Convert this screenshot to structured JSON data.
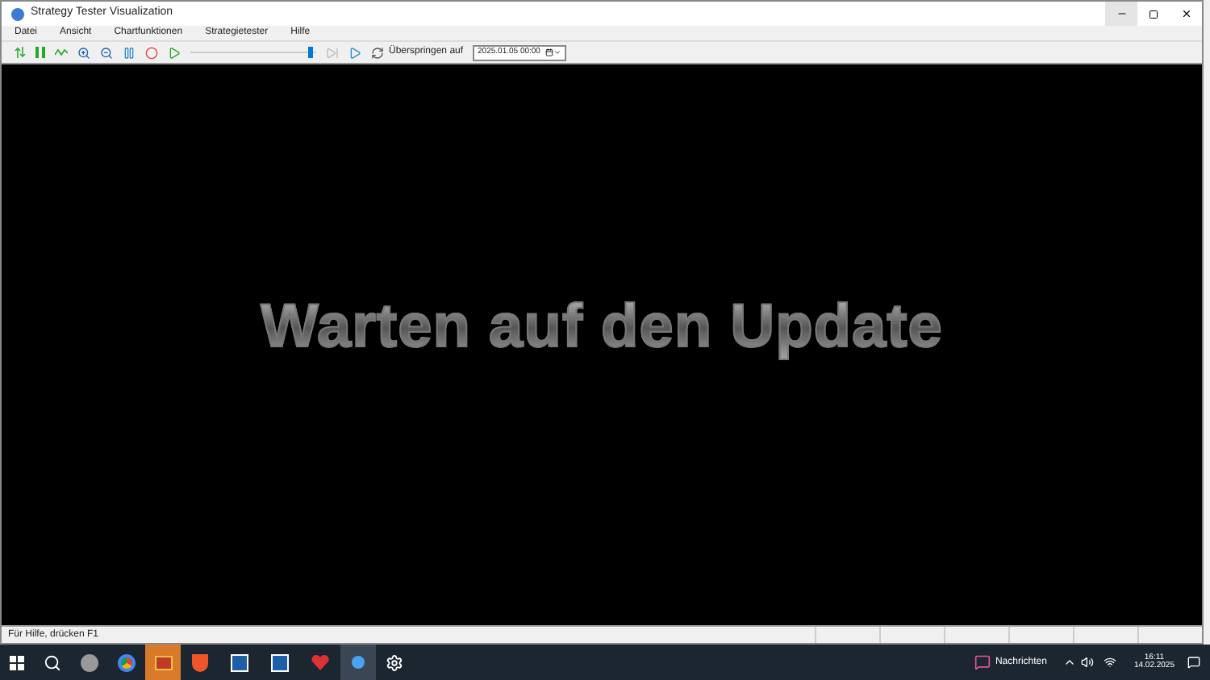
{
  "window": {
    "title": "Strategy Tester Visualization"
  },
  "menu": [
    "Datei",
    "Ansicht",
    "Chartfunktionen",
    "Strategietester",
    "Hilfe"
  ],
  "toolbar": {
    "speed": {
      "level": 0.97
    },
    "jump_label": "Überspringen auf",
    "jump_date": "2025.01.05 00:00"
  },
  "canvas": {
    "message": "Warten auf den Update"
  },
  "status_bar": {
    "text": "Für Hilfe, drücken F1"
  },
  "taskbar": {
    "news": "Nachrichten",
    "time": "16:11",
    "date": "14.02.2025"
  }
}
